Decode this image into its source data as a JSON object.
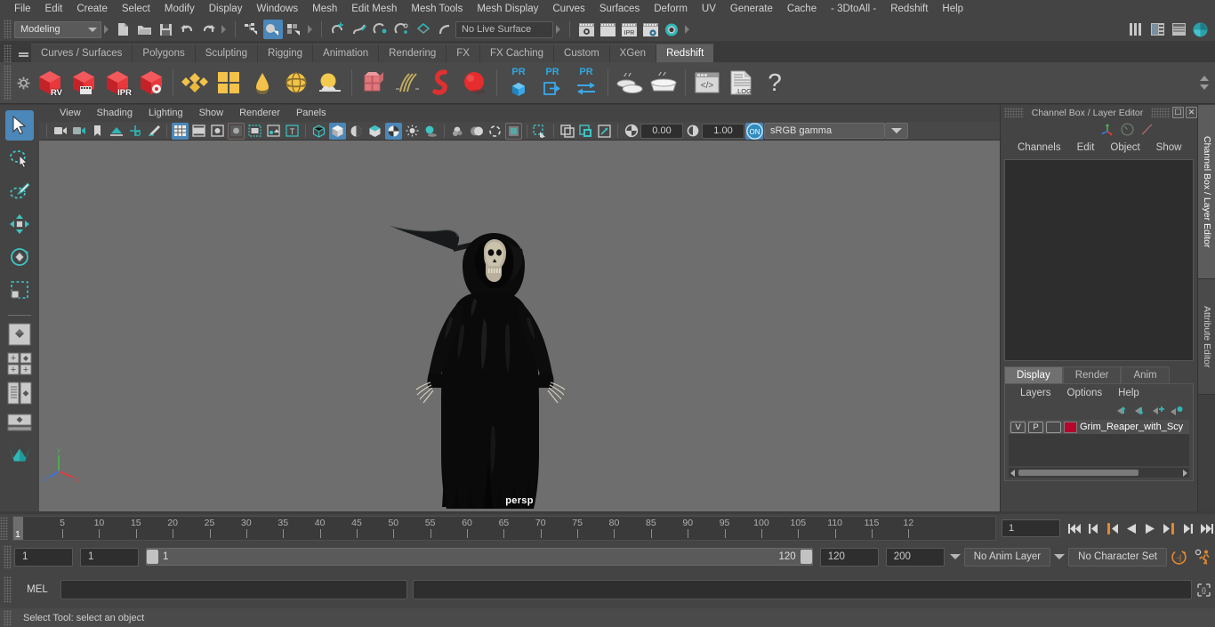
{
  "app": {
    "title": "Autodesk Maya",
    "menu_bar": [
      "File",
      "Edit",
      "Create",
      "Select",
      "Modify",
      "Display",
      "Windows",
      "Mesh",
      "Edit Mesh",
      "Mesh Tools",
      "Mesh Display",
      "Curves",
      "Surfaces",
      "Deform",
      "UV",
      "Generate",
      "Cache",
      "- 3DtoAll -",
      "Redshift",
      "Help"
    ]
  },
  "status_line": {
    "menu_set": "Modeling",
    "live_surface": "No Live Surface",
    "buttons": [
      "new-scene",
      "open-scene",
      "save-scene",
      "undo",
      "redo",
      "select-by-hierarchy",
      "select-by-object-type",
      "select-by-component-type",
      "snap-to-grid",
      "snap-to-curve",
      "snap-to-point",
      "snap-to-projected-center",
      "snap-to-view-plane",
      "make-live",
      "render-view",
      "render-current-frame",
      "ipr-render",
      "render-settings",
      "hypershade",
      "toggle-sidebar"
    ]
  },
  "shelf": {
    "tabs": [
      "Curves / Surfaces",
      "Polygons",
      "Sculpting",
      "Rigging",
      "Animation",
      "Rendering",
      "FX",
      "FX Caching",
      "Custom",
      "XGen",
      "Redshift"
    ],
    "selected_tab": "Redshift",
    "items": [
      {
        "name": "redshift-render-view",
        "label": "RV"
      },
      {
        "name": "redshift-render-sequence",
        "label": ""
      },
      {
        "name": "redshift-ipr",
        "label": "IPR"
      },
      {
        "name": "redshift-render-settings",
        "label": ""
      },
      {
        "name": "redshift-material",
        "label": ""
      },
      {
        "name": "redshift-material-blender",
        "label": ""
      },
      {
        "name": "redshift-bokeh",
        "label": ""
      },
      {
        "name": "redshift-environment",
        "label": ""
      },
      {
        "name": "redshift-dome-light",
        "label": ""
      },
      {
        "name": "redshift-physical-sun-sky",
        "label": ""
      },
      {
        "name": "redshift-proxy",
        "label": ""
      },
      {
        "name": "redshift-hair",
        "label": ""
      },
      {
        "name": "redshift-volume",
        "label": ""
      },
      {
        "name": "redshift-sphere-light",
        "label": ""
      },
      {
        "name": "redshift-pr-cube",
        "label": "PR"
      },
      {
        "name": "redshift-pr-export",
        "label": "PR"
      },
      {
        "name": "redshift-pr-transfer",
        "label": "PR"
      },
      {
        "name": "redshift-bake-set",
        "label": ""
      },
      {
        "name": "redshift-bake",
        "label": ""
      },
      {
        "name": "redshift-script-editor",
        "label": ""
      },
      {
        "name": "redshift-log",
        "label": ".LOG"
      },
      {
        "name": "redshift-help",
        "label": "?"
      }
    ]
  },
  "toolbox": {
    "tools": [
      "select-tool",
      "lasso-select-tool",
      "paint-select-tool",
      "move-tool",
      "rotate-tool",
      "scale-tool"
    ],
    "selected": "select-tool",
    "layouts": [
      "single-perspective-view",
      "four-view",
      "persp-outliner",
      "outliner-persp-graph",
      "hypershade-persp"
    ]
  },
  "viewport": {
    "menus": [
      "View",
      "Shading",
      "Lighting",
      "Show",
      "Renderer",
      "Panels"
    ],
    "camera_label": "persp",
    "exposure": "0.00",
    "gamma": "1.00",
    "color_management_toggle": "ON",
    "view_transform": "sRGB gamma",
    "background_color": "#6e6e6e",
    "toolbar_buttons": [
      "select-camera",
      "camera-attributes",
      "bookmark",
      "image-plane",
      "two-d-pan-zoom",
      "grease-pencil",
      "grid-toggle",
      "film-gate",
      "resolution-gate",
      "gate-mask",
      "film-origin",
      "safe-action",
      "title-safe",
      "wireframe-shaded",
      "smooth-shade-all",
      "hardware-texturing",
      "use-default-lights",
      "shadows",
      "screen-space-ao",
      "motion-blur",
      "multisample-aa",
      "isolate-select",
      "xray",
      "xray-joints",
      "xray-active-components",
      "exposure-icon",
      "gamma-icon",
      "color-management"
    ]
  },
  "right_panel": {
    "title": "Channel Box / Layer Editor",
    "window_buttons": [
      "restore",
      "close"
    ],
    "channel_menus": [
      "Channels",
      "Edit",
      "Object",
      "Show"
    ],
    "layer_tabs": [
      "Display",
      "Render",
      "Anim"
    ],
    "selected_layer_tab": "Display",
    "layer_menus": [
      "Layers",
      "Options",
      "Help"
    ],
    "layer_tool_icons": [
      "move-layer-up",
      "move-layer-down",
      "create-new-layer",
      "create-layer-from-selected"
    ],
    "layers": [
      {
        "visibility": "V",
        "playback": "P",
        "shading": "",
        "color": "#b5072b",
        "name": "Grim_Reaper_with_Scy"
      }
    ],
    "vertical_tabs": [
      "Channel Box / Layer Editor",
      "Attribute Editor"
    ]
  },
  "time_slider": {
    "tick_labels": [
      "5",
      "10",
      "15",
      "20",
      "25",
      "30",
      "35",
      "40",
      "45",
      "50",
      "55",
      "60",
      "65",
      "70",
      "75",
      "80",
      "85",
      "90",
      "95",
      "100",
      "105",
      "110",
      "115",
      "12"
    ],
    "current_frame": "1",
    "playhead_label": "1",
    "current_frame_field": "1",
    "playback_buttons": [
      "go-to-start",
      "step-back-frame",
      "step-back-key",
      "play-backwards",
      "play-forwards",
      "step-forward-key",
      "step-forward-frame",
      "go-to-end"
    ]
  },
  "range_slider": {
    "anim_start": "1",
    "playback_start": "1",
    "range_left_label": "1",
    "range_right_label": "120",
    "playback_end": "120",
    "anim_end": "200",
    "anim_layer": "No Anim Layer",
    "character_set": "No Character Set",
    "buttons": [
      "auto-key-toggle",
      "animation-preferences"
    ]
  },
  "command_line": {
    "language_label": "MEL",
    "input_value": "",
    "script_editor_button": "script-editor-icon"
  },
  "help_line": {
    "message": "Select Tool: select an object"
  }
}
